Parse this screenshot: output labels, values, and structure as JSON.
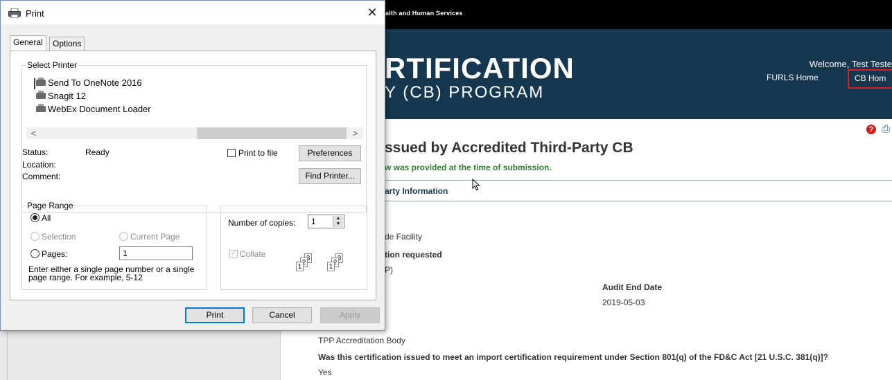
{
  "background_page": {
    "agency": "alth and Human Services",
    "banner_title": "RTIFICATION",
    "banner_subtitle": "Y (CB) PROGRAM",
    "welcome": "Welcome, Test Teste",
    "nav": {
      "furls_home": "FURLS Home",
      "cb_home": "CB Hom"
    },
    "icons": {
      "help": "help-icon",
      "print": "print-icon"
    },
    "page_title": "ssued by Accredited Third-Party CB",
    "page_note": "w was provided at the time of submission.",
    "tab_label": "arty Information",
    "lines": {
      "l1": "de Facility",
      "l2": "tion requested",
      "l3": "P)",
      "audit_end_label": "Audit End Date",
      "audit_end_value": "2019-05-03",
      "tpp_body": "TPP Accreditation Body",
      "question": "Was this certification issued to meet an import certification requirement under Section 801(q) of the FD&C Act [21 U.S.C. 381(q)]?",
      "answer": "Yes"
    },
    "colors": {
      "banner": "#15374f",
      "note_green": "#2e7d32",
      "highlight_red": "#e02020"
    }
  },
  "dialog": {
    "title": "Print",
    "close_glyph": "✕",
    "tabs": [
      {
        "label": "General"
      },
      {
        "label": "Options"
      }
    ],
    "select_printer": {
      "legend": "Select Printer",
      "printers": [
        "Send To OneNote 2016",
        "Snagit 12",
        "WebEx Document Loader"
      ],
      "scroll_left": "<",
      "scroll_right": ">"
    },
    "status_label": "Status:",
    "status_value": "Ready",
    "location_label": "Location:",
    "comment_label": "Comment:",
    "print_to_file": "Print to file",
    "preferences": "Preferences",
    "find_printer": "Find Printer...",
    "page_range": {
      "legend": "Page Range",
      "all": "All",
      "selection": "Selection",
      "current_page": "Current Page",
      "pages": "Pages:",
      "pages_value": "1",
      "hint": "Enter either a single page number or a single page range.  For example, 5-12"
    },
    "copies": {
      "label": "Number of copies:",
      "value": "1",
      "collate": "Collate",
      "collate_checked": true
    },
    "buttons": {
      "print": "Print",
      "cancel": "Cancel",
      "apply": "Apply"
    }
  }
}
